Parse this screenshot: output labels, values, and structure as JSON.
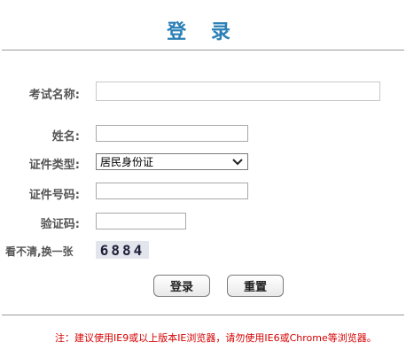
{
  "page": {
    "title": "登 录"
  },
  "form": {
    "exam_name_label": "考试名称:",
    "exam_name_value": "",
    "name_label": "姓名:",
    "name_value": "",
    "id_type_label": "证件类型:",
    "id_type_selected": "居民身份证",
    "id_number_label": "证件号码:",
    "id_number_value": "",
    "verify_label": "验证码:",
    "verify_value": "",
    "refresh_label": "看不清,换一张",
    "captcha_text": "6884"
  },
  "buttons": {
    "login": "登录",
    "reset": "重置"
  },
  "footer": {
    "note": "注：建议使用IE9或以上版本IE浏览器，请勿使用IE6或Chrome等浏览器。"
  },
  "colors": {
    "title": "#2a7fb6",
    "note": "#d40000"
  }
}
